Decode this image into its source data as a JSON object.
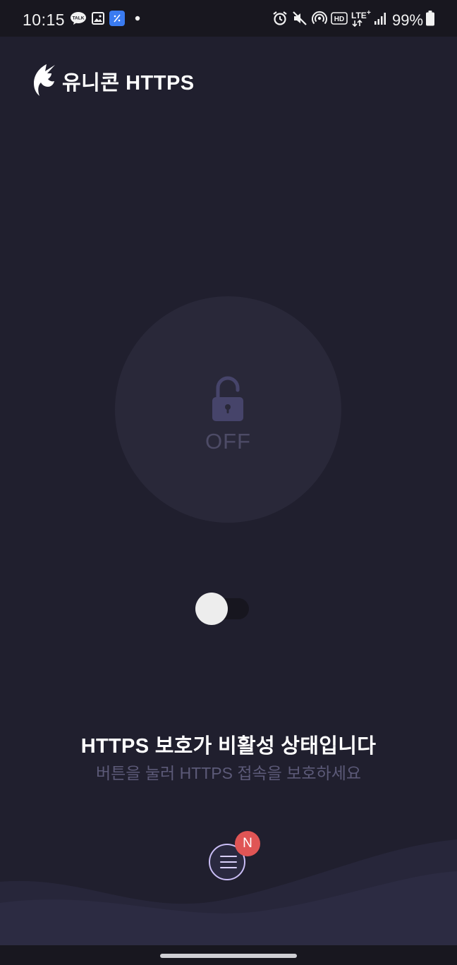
{
  "status_bar": {
    "time": "10:15",
    "notification_icons": [
      "kakaotalk-icon",
      "gallery-icon",
      "app-icon",
      "dot-icon"
    ],
    "system_icons": [
      "alarm-icon",
      "mute-icon",
      "hotspot-icon",
      "hd-icon",
      "lte-plus-icon",
      "signal-icon"
    ],
    "battery": "99%",
    "kakao_label": "TALK"
  },
  "header": {
    "title": "유니콘 HTTPS",
    "logo_icon": "unicorn-logo-icon"
  },
  "protection": {
    "state_label": "OFF",
    "lock_icon": "unlocked-padlock-icon",
    "toggle_on": false
  },
  "message": {
    "title": "HTTPS 보호가 비활성 상태입니다",
    "subtitle": "버튼을 눌러 HTTPS 접속을 보호하세요"
  },
  "menu": {
    "icon": "hamburger-menu-icon",
    "badge": "N"
  },
  "colors": {
    "background": "#201f2e",
    "circle": "#292839",
    "lock": "#46446a",
    "badge": "#e05555",
    "menu_border": "#c9bdf5"
  }
}
